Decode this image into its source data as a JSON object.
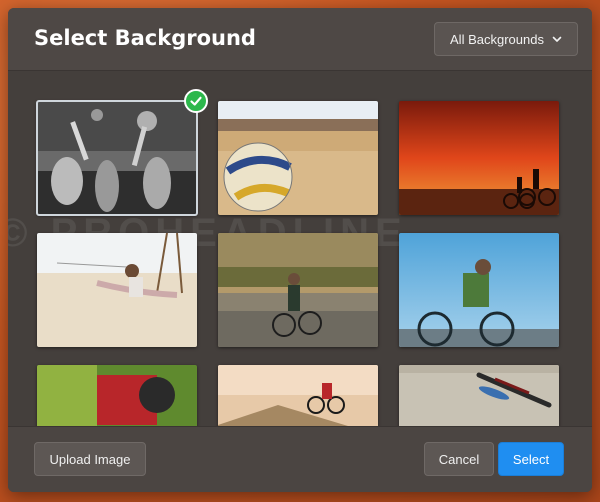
{
  "dialog": {
    "title": "Select Background",
    "filter": {
      "selected": "All Backgrounds",
      "icon": "chevron-down-icon"
    }
  },
  "grid": {
    "watermark": "© PROHEADLINE",
    "thumbnails": [
      {
        "name": "concert-crowd",
        "selected": true
      },
      {
        "name": "volleyball-beach",
        "selected": false
      },
      {
        "name": "sunset-cyclists",
        "selected": false
      },
      {
        "name": "beach-swing",
        "selected": false
      },
      {
        "name": "road-cyclist",
        "selected": false
      },
      {
        "name": "city-cyclist",
        "selected": false
      },
      {
        "name": "mountain-biker",
        "selected": false
      },
      {
        "name": "bmx-jump",
        "selected": false
      },
      {
        "name": "fishing-rod",
        "selected": false
      }
    ],
    "selected_badge_icon": "checkmark-icon"
  },
  "footer": {
    "upload_label": "Upload Image",
    "cancel_label": "Cancel",
    "select_label": "Select"
  },
  "colors": {
    "primary": "#1f8ef1",
    "check": "#2db84c",
    "dialog_bg": "#4b4542"
  }
}
